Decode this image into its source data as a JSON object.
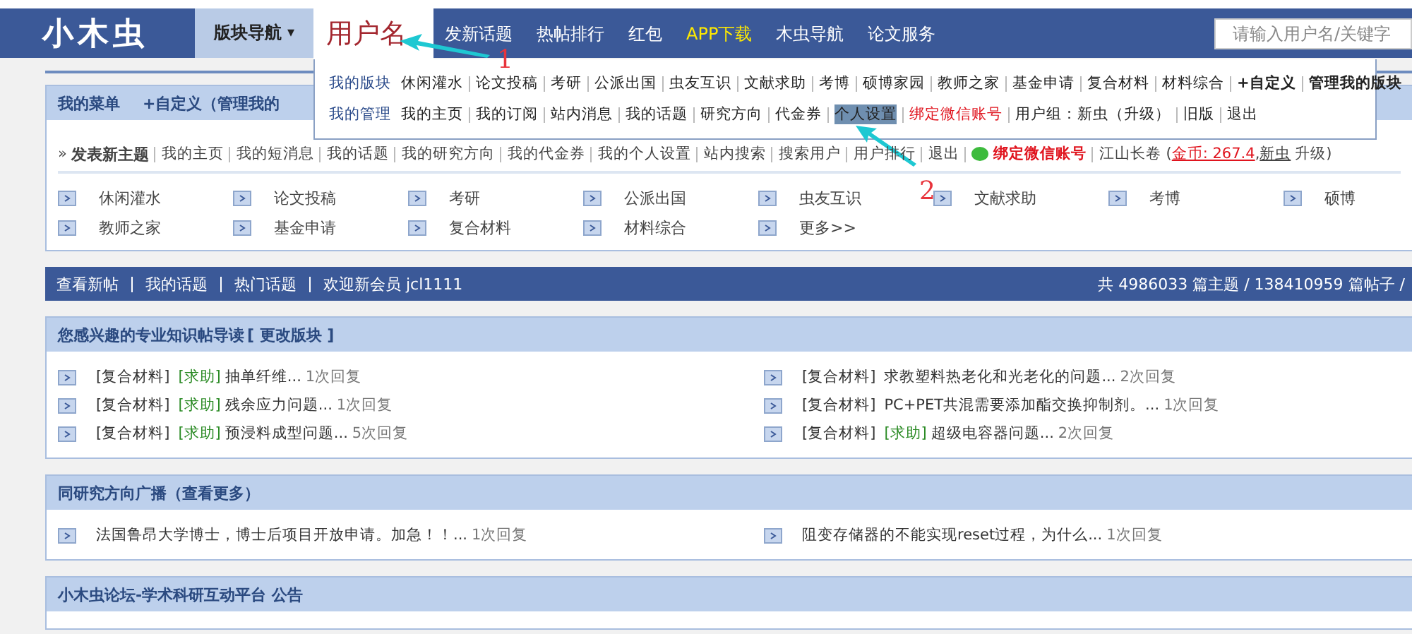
{
  "nav": {
    "logo": "小木虫",
    "forum_nav": {
      "label": "版块导航",
      "caret": "▾"
    },
    "items": [
      {
        "label": "发新话题",
        "kind": "normal"
      },
      {
        "label": "热帖排行",
        "kind": "normal"
      },
      {
        "label": "红包",
        "kind": "normal"
      },
      {
        "label": "APP下载",
        "kind": "highlight"
      },
      {
        "label": "木虫导航",
        "kind": "normal"
      },
      {
        "label": "论文服务",
        "kind": "normal"
      }
    ],
    "search": {
      "placeholder": "请输入用户名/关键字"
    }
  },
  "user_menu": {
    "username": "用户名",
    "rows": [
      {
        "label": "我的版块",
        "links": [
          {
            "label": "休闲灌水",
            "kind": "normal",
            "selected": false
          },
          {
            "label": "论文投稿",
            "kind": "normal",
            "selected": false
          },
          {
            "label": "考研",
            "kind": "normal",
            "selected": false
          },
          {
            "label": "公派出国",
            "kind": "normal",
            "selected": false
          },
          {
            "label": "虫友互识",
            "kind": "normal",
            "selected": false
          },
          {
            "label": "文献求助",
            "kind": "normal",
            "selected": false
          },
          {
            "label": "考博",
            "kind": "normal",
            "selected": false
          },
          {
            "label": "硕博家园",
            "kind": "normal",
            "selected": false
          },
          {
            "label": "教师之家",
            "kind": "normal",
            "selected": false
          },
          {
            "label": "基金申请",
            "kind": "normal",
            "selected": false
          },
          {
            "label": "复合材料",
            "kind": "normal",
            "selected": false
          },
          {
            "label": "材料综合",
            "kind": "normal",
            "selected": false
          },
          {
            "label": "+自定义",
            "kind": "bold",
            "selected": false
          },
          {
            "label": "管理我的版块",
            "kind": "bold",
            "selected": false
          }
        ]
      },
      {
        "label": "我的管理",
        "links": [
          {
            "label": "我的主页",
            "kind": "normal",
            "selected": false
          },
          {
            "label": "我的订阅",
            "kind": "normal",
            "selected": false
          },
          {
            "label": "站内消息",
            "kind": "normal",
            "selected": false
          },
          {
            "label": "我的话题",
            "kind": "normal",
            "selected": false
          },
          {
            "label": "研究方向",
            "kind": "normal",
            "selected": false
          },
          {
            "label": "代金券",
            "kind": "normal",
            "selected": false
          },
          {
            "label": "个人设置",
            "kind": "normal",
            "selected": true
          },
          {
            "label": "绑定微信账号",
            "kind": "alert",
            "selected": false
          },
          {
            "label": "用户组：新虫（升级）",
            "kind": "normal",
            "selected": false
          },
          {
            "label": "旧版",
            "kind": "normal",
            "selected": false
          },
          {
            "label": "退出",
            "kind": "normal",
            "selected": false
          }
        ]
      }
    ]
  },
  "annotations": [
    {
      "text": "1"
    },
    {
      "text": "2"
    }
  ],
  "my_menu": {
    "title": "我的菜单",
    "customize": "+自定义（管理我的",
    "marker": "»",
    "quick_links": [
      {
        "label": "发表新主题",
        "kind": "bold"
      },
      {
        "label": "我的主页",
        "kind": "normal"
      },
      {
        "label": "我的短消息",
        "kind": "normal"
      },
      {
        "label": "我的话题",
        "kind": "normal"
      },
      {
        "label": "我的研究方向",
        "kind": "normal"
      },
      {
        "label": "我的代金券",
        "kind": "normal"
      },
      {
        "label": "我的个人设置",
        "kind": "normal"
      },
      {
        "label": "站内搜索",
        "kind": "normal"
      },
      {
        "label": "搜索用户",
        "kind": "normal"
      },
      {
        "label": "用户排行",
        "kind": "normal"
      },
      {
        "label": "退出",
        "kind": "normal"
      }
    ],
    "wechat": "绑定微信账号",
    "account": {
      "prefix": "江山长卷 (",
      "coins": "金币: 267.4",
      "separator": ",",
      "group": "新虫",
      "suffix": "升级)"
    },
    "boards": [
      "休闲灌水",
      "论文投稿",
      "考研",
      "公派出国",
      "虫友互识",
      "文献求助",
      "考博",
      "硕博",
      "教师之家",
      "基金申请",
      "复合材料",
      "材料综合",
      "更多>>"
    ]
  },
  "stats_bar": {
    "links": [
      "查看新帖",
      "我的话题",
      "热门话题",
      "欢迎新会员 jcl1111"
    ],
    "totals": "共 4986033 篇主题 / 138410959 篇帖子 /"
  },
  "panels": [
    {
      "title": "您感兴趣的专业知识帖导读",
      "action": "[ 更改版块 ]",
      "threads": [
        {
          "category": "[复合材料]",
          "tag": "[求助]",
          "title": "抽单纤维...",
          "replies": "1次回复"
        },
        {
          "category": "[复合材料]",
          "title": "求教塑料热老化和光老化的问题...",
          "replies": "2次回复"
        },
        {
          "category": "[复合材料]",
          "tag": "[求助]",
          "title": "残余应力问题...",
          "replies": "1次回复"
        },
        {
          "category": "[复合材料]",
          "title": "PC+PET共混需要添加酯交换抑制剂。...",
          "replies": "1次回复"
        },
        {
          "category": "[复合材料]",
          "tag": "[求助]",
          "title": "预浸料成型问题...",
          "replies": "5次回复"
        },
        {
          "category": "[复合材料]",
          "tag": "[求助]",
          "title": "超级电容器问题...",
          "replies": "2次回复"
        }
      ]
    },
    {
      "title": "同研究方向广播（查看更多）",
      "threads": [
        {
          "title": "法国鲁昂大学博士，博士后项目开放申请。加急！！...",
          "replies": "1次回复"
        },
        {
          "title": "阻变存储器的不能实现reset过程，为什么...",
          "replies": "1次回复"
        }
      ]
    },
    {
      "title": "小木虫论坛-学术科研互动平台 公告"
    }
  ]
}
